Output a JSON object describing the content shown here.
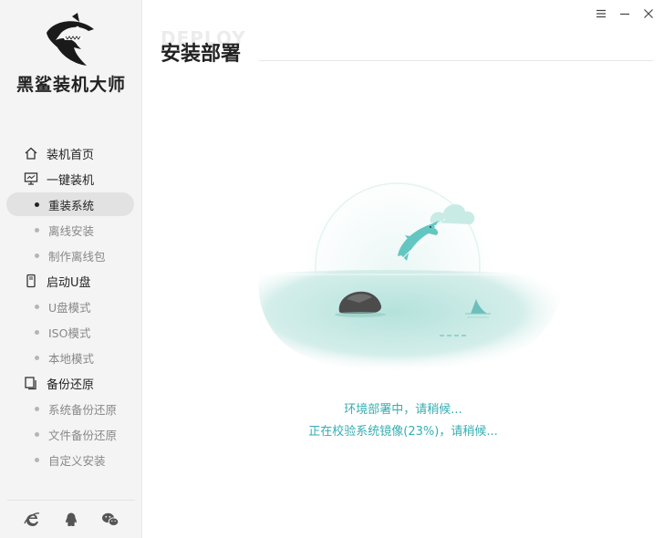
{
  "app": {
    "name": "黑鲨装机大师",
    "logo_icon": "shark-logo-icon"
  },
  "window_controls": [
    {
      "name": "menu-icon",
      "glyph": "☰"
    },
    {
      "name": "minimize-icon",
      "glyph": "—"
    },
    {
      "name": "close-icon",
      "glyph": "✕"
    }
  ],
  "sidebar": {
    "items": [
      {
        "label": "装机首页",
        "level": "top",
        "icon": "home-icon"
      },
      {
        "label": "一键装机",
        "level": "top",
        "icon": "monitor-icon"
      },
      {
        "label": "重装系统",
        "level": "sub",
        "active": true
      },
      {
        "label": "离线安装",
        "level": "sub"
      },
      {
        "label": "制作离线包",
        "level": "sub"
      },
      {
        "label": "启动U盘",
        "level": "top",
        "icon": "usb-drive-icon"
      },
      {
        "label": "U盘模式",
        "level": "sub"
      },
      {
        "label": "ISO模式",
        "level": "sub"
      },
      {
        "label": "本地模式",
        "level": "sub"
      },
      {
        "label": "备份还原",
        "level": "top",
        "icon": "backup-icon"
      },
      {
        "label": "系统备份还原",
        "level": "sub"
      },
      {
        "label": "文件备份还原",
        "level": "sub"
      },
      {
        "label": "自定义安装",
        "level": "sub"
      }
    ],
    "footer_icons": [
      "ie-browser-icon",
      "qq-icon",
      "wechat-icon"
    ]
  },
  "header": {
    "watermark": "DEPLOY",
    "title": "安装部署"
  },
  "status": {
    "line1": "环境部署中，请稍候...",
    "line2": "正在校验系统镜像(23%)，请稍候..."
  },
  "colors": {
    "accent": "#36aeb3",
    "sidebar_bg": "#f4f4f4",
    "water": "#bfe6e2"
  }
}
